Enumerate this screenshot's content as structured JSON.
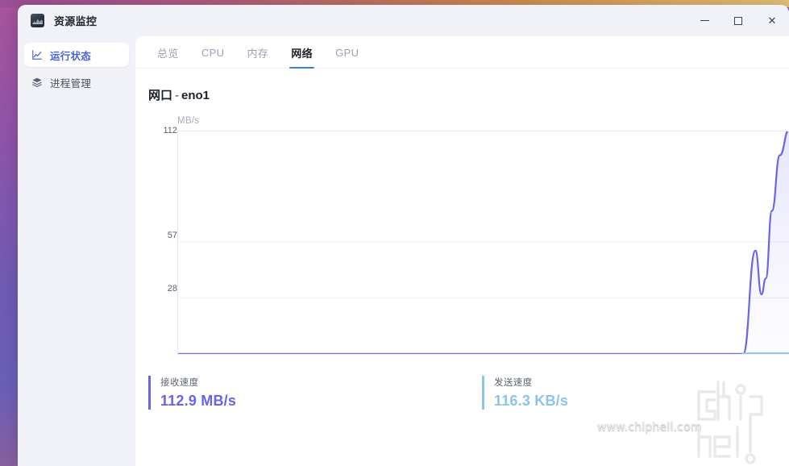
{
  "window": {
    "title": "资源监控",
    "app_icon": "chart-app-icon",
    "controls": {
      "minimize": "minimize-icon",
      "maximize": "maximize-icon",
      "close": "close-icon"
    }
  },
  "sidebar": {
    "items": [
      {
        "label": "运行状态",
        "icon": "line-chart-icon",
        "active": true
      },
      {
        "label": "进程管理",
        "icon": "layers-icon",
        "active": false
      }
    ]
  },
  "tabs": [
    {
      "label": "总览",
      "active": false
    },
    {
      "label": "CPU",
      "active": false
    },
    {
      "label": "内存",
      "active": false
    },
    {
      "label": "网络",
      "active": true
    },
    {
      "label": "GPU",
      "active": false
    }
  ],
  "chart_header": {
    "prefix": "网口",
    "separator": "-",
    "interface": "eno1"
  },
  "chart_data": {
    "type": "line",
    "title": "网口 - eno1",
    "unit": "MB/s",
    "ylabel": "MB/s",
    "xlabel": "",
    "yticks": [
      "112",
      "57",
      "28"
    ],
    "ytick_values": [
      112,
      57,
      28
    ],
    "ylim": [
      0,
      112
    ],
    "grid": true,
    "legend": "none",
    "series": [
      {
        "name": "接收速度",
        "color": "#6b63e8",
        "fill": "rgba(107,99,232,0.13)",
        "x": [
          0.0,
          0.9,
          0.925,
          0.945,
          0.955,
          0.962,
          0.972,
          0.985,
          1.0
        ],
        "values": [
          0,
          0,
          0,
          52,
          30,
          38,
          72,
          100,
          112.9
        ]
      },
      {
        "name": "发送速度",
        "color": "#8bc4e8",
        "fill": "rgba(139,196,232,0.15)",
        "x": [
          0.0,
          0.925,
          0.94,
          1.0
        ],
        "values": [
          0,
          0,
          0.12,
          0.12
        ]
      }
    ]
  },
  "stats": [
    {
      "label": "接收速度",
      "value": "112.9 MB/s",
      "color": "#6b63e8"
    },
    {
      "label": "发送速度",
      "value": "116.3 KB/s",
      "color": "#8bc4e8"
    }
  ],
  "watermark": {
    "url": "www.chiphell.com",
    "logo": "chiphell-logo"
  }
}
